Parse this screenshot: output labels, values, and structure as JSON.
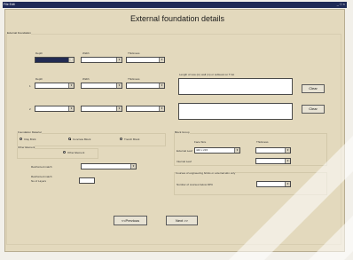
{
  "titlebar": {
    "menu": "File  Edit",
    "controls": "_ □ ×"
  },
  "page": {
    "title": "External foundation details"
  },
  "frame_label": "External Foundation",
  "row0": {
    "depth_label": "Depth",
    "width_label": "Width",
    "thickness_label": "Thickness",
    "depth_value": "",
    "width_value": "",
    "thickness_value": ""
  },
  "row1": {
    "index": "1",
    "depth_label": "Depth",
    "width_label": "Width",
    "thickness_label": "Thickness"
  },
  "row2": {
    "index": "2"
  },
  "right_panel": {
    "length_label": "Length of new (m) wall (m) or sublevel on T list"
  },
  "buttons": {
    "clear1": "Clear",
    "clear2": "Clear",
    "previous": "<<Previous",
    "next": "Next >>"
  },
  "foundation_material": {
    "label": "Foundation Material",
    "options": [
      "Clay Brick",
      "Concrete Block",
      "Trench Block"
    ],
    "selected_index": 1
  },
  "other_option": {
    "frame_label": "Other Element",
    "label": "Other Element"
  },
  "reinforced": {
    "match_label": "Reinforced match",
    "layers_label_1": "Reinforced match",
    "layers_label_2": "No of Layers"
  },
  "block_group": {
    "label": "Block Group",
    "face_size_label": "Face Size",
    "thickness_label": "Thickness",
    "external_leaf_label": "External Leaf",
    "external_leaf_value": "440 x 215",
    "internal_leaf_label": "Internal Leaf"
  },
  "courses": {
    "label": "Courses of engineering bricks or external skin only",
    "number_label": "Number of courses below DPC"
  }
}
